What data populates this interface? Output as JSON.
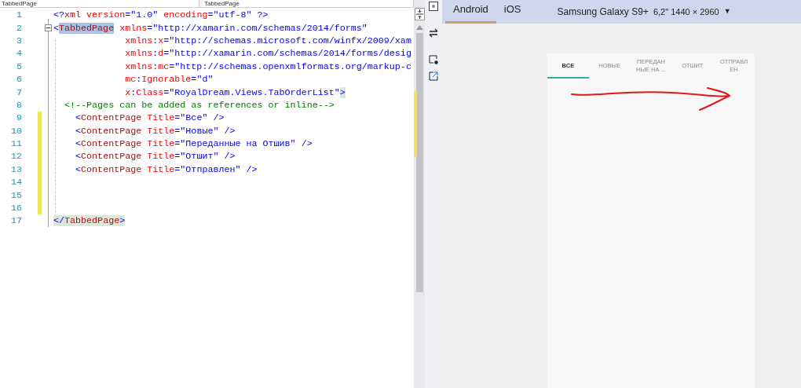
{
  "editor": {
    "dropdowns": [
      "TabbedPage",
      "TabbedPage"
    ],
    "lines": [
      {
        "number": "1",
        "segments": [
          {
            "kind": "bracket",
            "text": "<?"
          },
          {
            "kind": "element",
            "text": "xml"
          },
          {
            "kind": "attr",
            "text": " version"
          },
          {
            "kind": "bracket",
            "text": "="
          },
          {
            "kind": "value",
            "text": "\"1.0\""
          },
          {
            "kind": "attr",
            "text": " encoding"
          },
          {
            "kind": "bracket",
            "text": "="
          },
          {
            "kind": "value",
            "text": "\"utf-8\""
          },
          {
            "kind": "bracket",
            "text": " ?>"
          }
        ]
      },
      {
        "number": "2",
        "foldable": true,
        "segments": [
          {
            "kind": "bracket",
            "text": "<"
          },
          {
            "kind": "element",
            "text": "TabbedPage",
            "selected": true
          },
          {
            "kind": "attr",
            "text": " xmlns"
          },
          {
            "kind": "bracket",
            "text": "="
          },
          {
            "kind": "value",
            "text": "\"http://xamarin.com/schemas/2014/forms\""
          }
        ]
      },
      {
        "number": "3",
        "segments": [
          {
            "kind": "attr",
            "text": "             xmlns"
          },
          {
            "kind": "bracket",
            "text": ":"
          },
          {
            "kind": "attr",
            "text": "x"
          },
          {
            "kind": "bracket",
            "text": "="
          },
          {
            "kind": "value",
            "text": "\"http://schemas.microsoft.com/winfx/2009/xam"
          }
        ]
      },
      {
        "number": "4",
        "segments": [
          {
            "kind": "attr",
            "text": "             xmlns"
          },
          {
            "kind": "bracket",
            "text": ":"
          },
          {
            "kind": "attr",
            "text": "d"
          },
          {
            "kind": "bracket",
            "text": "="
          },
          {
            "kind": "value",
            "text": "\"http://xamarin.com/schemas/2014/forms/desig"
          }
        ]
      },
      {
        "number": "5",
        "segments": [
          {
            "kind": "attr",
            "text": "             xmlns"
          },
          {
            "kind": "bracket",
            "text": ":"
          },
          {
            "kind": "attr",
            "text": "mc"
          },
          {
            "kind": "bracket",
            "text": "="
          },
          {
            "kind": "value",
            "text": "\"http://schemas.openxmlformats.org/markup-c"
          }
        ]
      },
      {
        "number": "6",
        "segments": [
          {
            "kind": "attr",
            "text": "             mc"
          },
          {
            "kind": "bracket",
            "text": ":"
          },
          {
            "kind": "attr",
            "text": "Ignorable"
          },
          {
            "kind": "bracket",
            "text": "="
          },
          {
            "kind": "value",
            "text": "\"d\""
          }
        ]
      },
      {
        "number": "7",
        "segments": [
          {
            "kind": "attr",
            "text": "             x"
          },
          {
            "kind": "bracket",
            "text": ":"
          },
          {
            "kind": "attr",
            "text": "Class"
          },
          {
            "kind": "bracket",
            "text": "="
          },
          {
            "kind": "value",
            "text": "\"RoyalDream.Views.TabOrderList\""
          },
          {
            "kind": "bracket",
            "text": ">",
            "matched": true
          }
        ]
      },
      {
        "number": "8",
        "segments": [
          {
            "kind": "comment",
            "text": "  <!--Pages can be added as references or inline-->"
          }
        ]
      },
      {
        "number": "9",
        "changed": true,
        "segments": [
          {
            "kind": "bracket",
            "text": "    <"
          },
          {
            "kind": "element",
            "text": "ContentPage"
          },
          {
            "kind": "attr",
            "text": " Title"
          },
          {
            "kind": "bracket",
            "text": "="
          },
          {
            "kind": "value",
            "text": "\"Все\""
          },
          {
            "kind": "bracket",
            "text": " />"
          }
        ]
      },
      {
        "number": "10",
        "changed": true,
        "segments": [
          {
            "kind": "bracket",
            "text": "    <"
          },
          {
            "kind": "element",
            "text": "ContentPage"
          },
          {
            "kind": "attr",
            "text": " Title"
          },
          {
            "kind": "bracket",
            "text": "="
          },
          {
            "kind": "value",
            "text": "\"Новые\""
          },
          {
            "kind": "bracket",
            "text": " />"
          }
        ]
      },
      {
        "number": "11",
        "changed": true,
        "segments": [
          {
            "kind": "bracket",
            "text": "    <"
          },
          {
            "kind": "element",
            "text": "ContentPage"
          },
          {
            "kind": "attr",
            "text": " Title"
          },
          {
            "kind": "bracket",
            "text": "="
          },
          {
            "kind": "value",
            "text": "\"Переданные на Отшив\""
          },
          {
            "kind": "bracket",
            "text": " />"
          }
        ]
      },
      {
        "number": "12",
        "changed": true,
        "segments": [
          {
            "kind": "bracket",
            "text": "    <"
          },
          {
            "kind": "element",
            "text": "ContentPage"
          },
          {
            "kind": "attr",
            "text": " Title"
          },
          {
            "kind": "bracket",
            "text": "="
          },
          {
            "kind": "value",
            "text": "\"Отшит\""
          },
          {
            "kind": "bracket",
            "text": " />"
          }
        ]
      },
      {
        "number": "13",
        "changed": true,
        "segments": [
          {
            "kind": "bracket",
            "text": "    <"
          },
          {
            "kind": "element",
            "text": "ContentPage"
          },
          {
            "kind": "attr",
            "text": " Title"
          },
          {
            "kind": "bracket",
            "text": "="
          },
          {
            "kind": "value",
            "text": "\"Отправлен\""
          },
          {
            "kind": "bracket",
            "text": " />"
          }
        ]
      },
      {
        "number": "14",
        "changed": true
      },
      {
        "number": "15",
        "changed": true
      },
      {
        "number": "16",
        "changed": true
      },
      {
        "number": "17",
        "segments": [
          {
            "kind": "bracket",
            "text": "</",
            "matched": true
          },
          {
            "kind": "element",
            "text": "TabbedPage",
            "matched": true
          },
          {
            "kind": "bracket",
            "text": ">",
            "matched": true
          }
        ]
      }
    ]
  },
  "preview": {
    "platform_tabs": [
      {
        "label": "Android",
        "selected": true
      },
      {
        "label": "iOS",
        "selected": false
      }
    ],
    "device": {
      "name": "Samsung Galaxy S9+",
      "spec": "6,2\" 1440 × 2960",
      "caret": "▼"
    },
    "app_tabs": [
      {
        "lines": [
          "ВСЕ"
        ],
        "selected": true
      },
      {
        "lines": [
          "НОВЫЕ"
        ],
        "selected": false
      },
      {
        "lines": [
          "ПЕРЕДАН",
          "НЫЕ НА ..."
        ],
        "selected": false
      },
      {
        "lines": [
          "ОТШИТ"
        ],
        "selected": false
      },
      {
        "lines": [
          "ОТПРАВЛ",
          "ЕН"
        ],
        "selected": false
      }
    ]
  }
}
